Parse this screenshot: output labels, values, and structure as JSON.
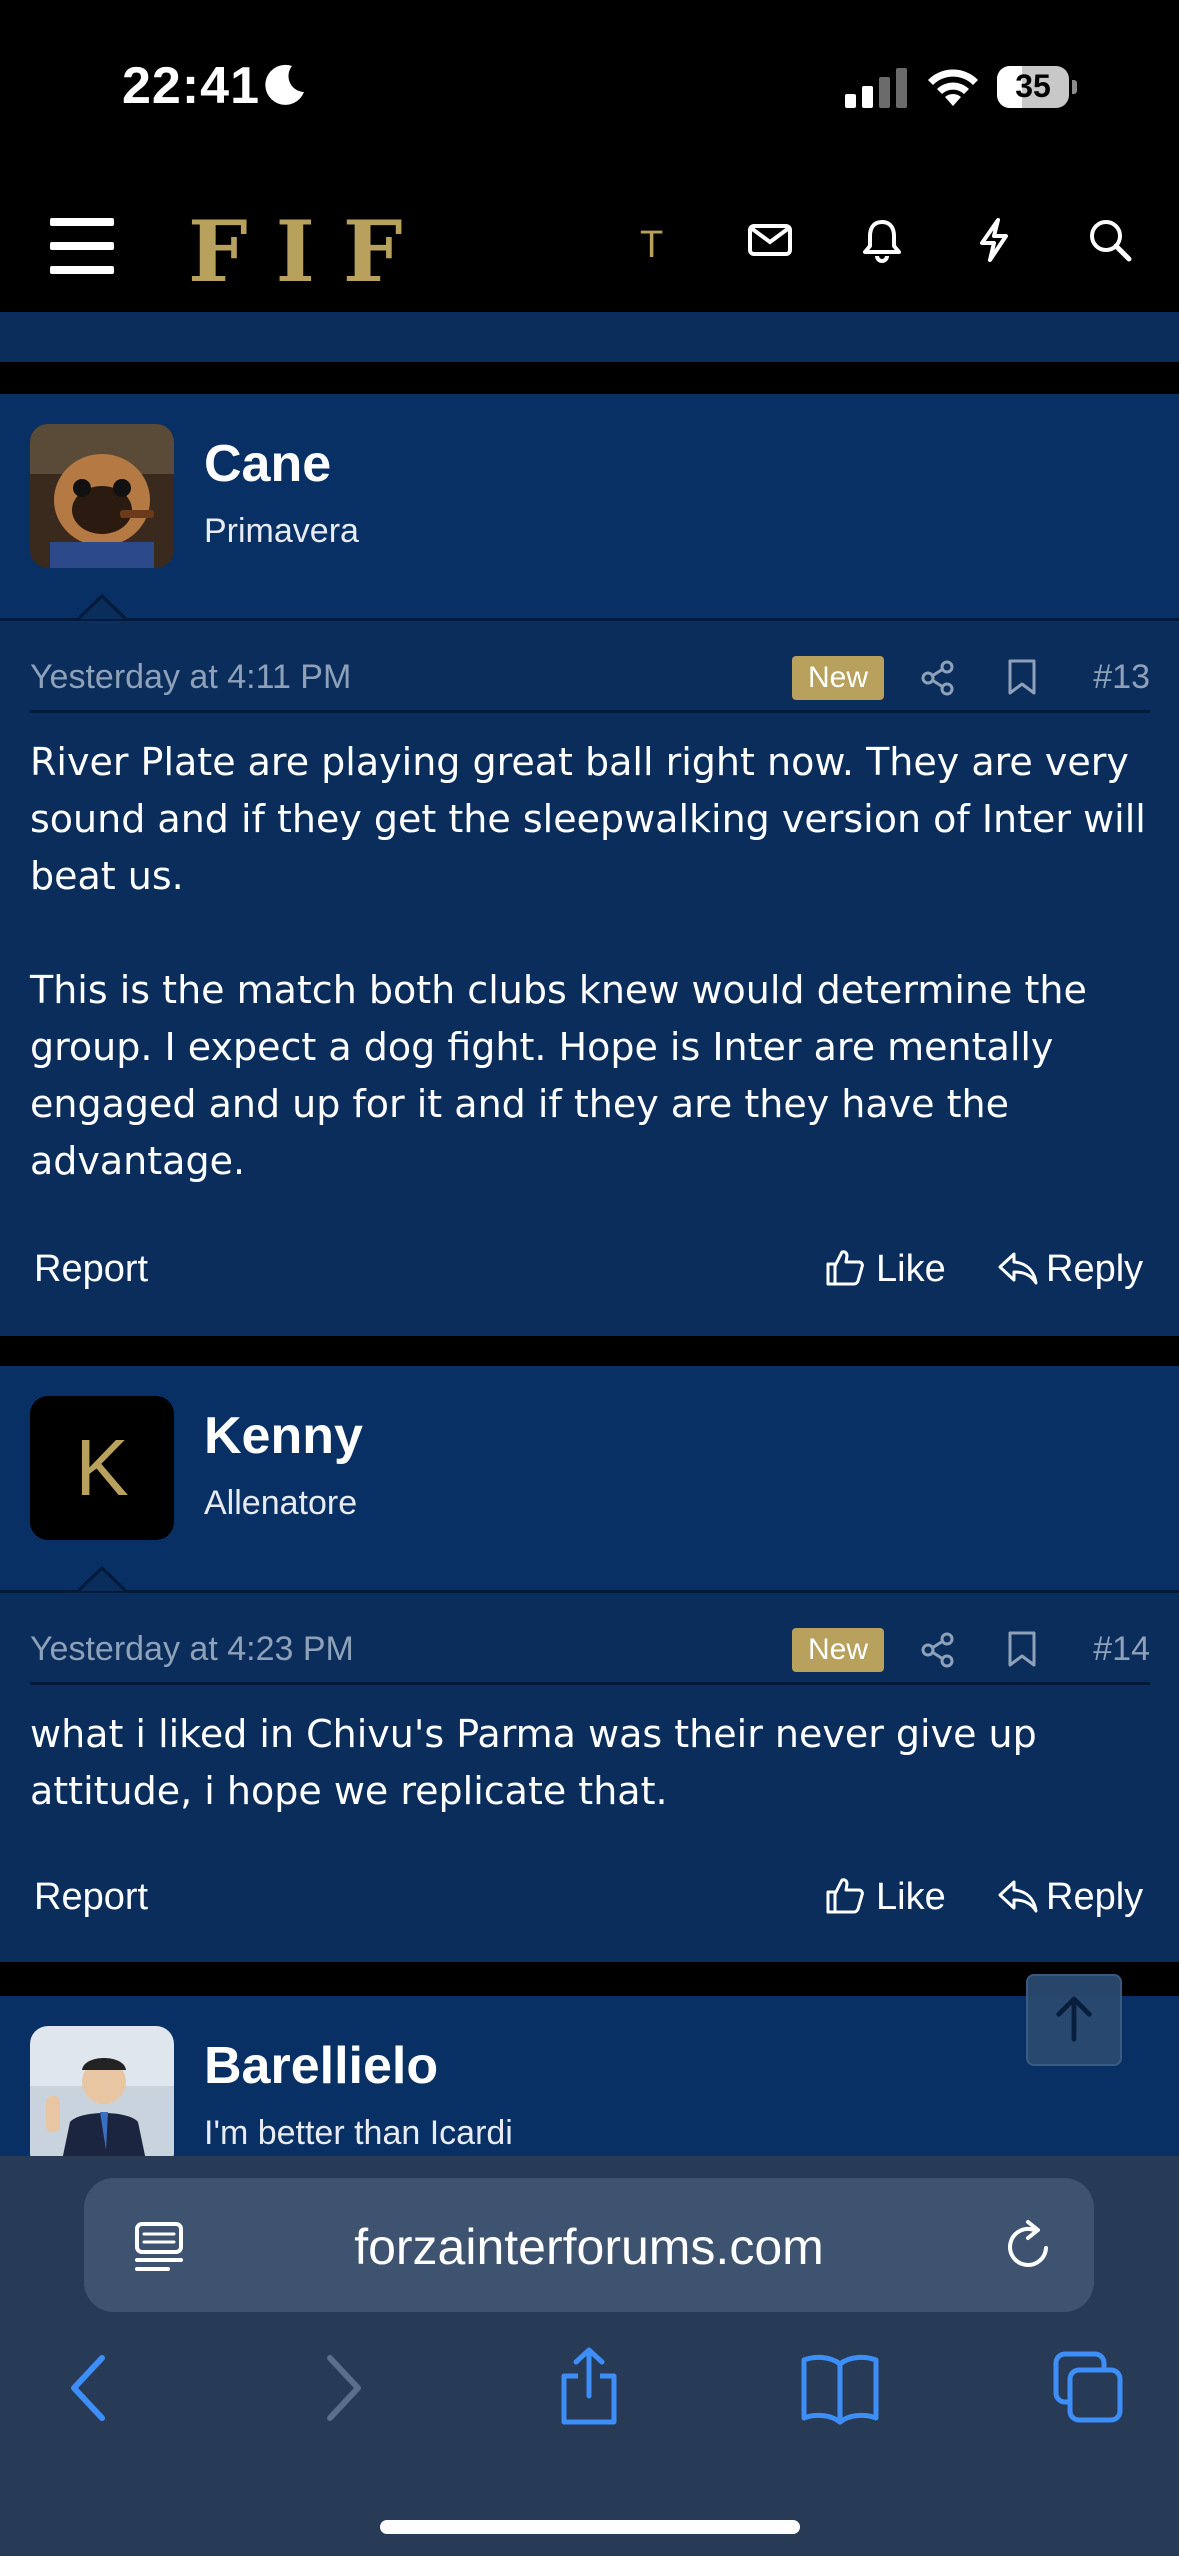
{
  "status_bar": {
    "time": "22:41",
    "battery": "35"
  },
  "header": {
    "logo": "FIF",
    "user_initial": "T"
  },
  "posts": [
    {
      "username": "Cane",
      "user_title": "Primavera",
      "date": "Yesterday at 4:11 PM",
      "badge": "New",
      "number": "#13",
      "paragraphs": [
        "River Plate are playing great ball right now. They are very sound and if they get the sleepwalking version of Inter will beat us.",
        "This is the match both clubs knew would determine the group. I expect a dog fight. Hope is Inter are mentally engaged and up for it and if they are they have the advantage."
      ],
      "report_label": "Report",
      "like_label": "Like",
      "reply_label": "Reply"
    },
    {
      "username": "Kenny",
      "user_title": "Allenatore",
      "avatar_letter": "K",
      "date": "Yesterday at 4:23 PM",
      "badge": "New",
      "number": "#14",
      "paragraphs": [
        "what i liked in Chivu's Parma was their never give up attitude, i hope we replicate that."
      ],
      "report_label": "Report",
      "like_label": "Like",
      "reply_label": "Reply"
    },
    {
      "username": "Barellielo",
      "user_title": "I'm better than Icardi"
    }
  ],
  "browser": {
    "url": "forzainterforums.com"
  },
  "colors": {
    "post_bg": "#0a2d5c",
    "accent_gold": "#b7a15c",
    "toolbar_bg": "#273b57",
    "link_blue": "#3e8ef7"
  }
}
